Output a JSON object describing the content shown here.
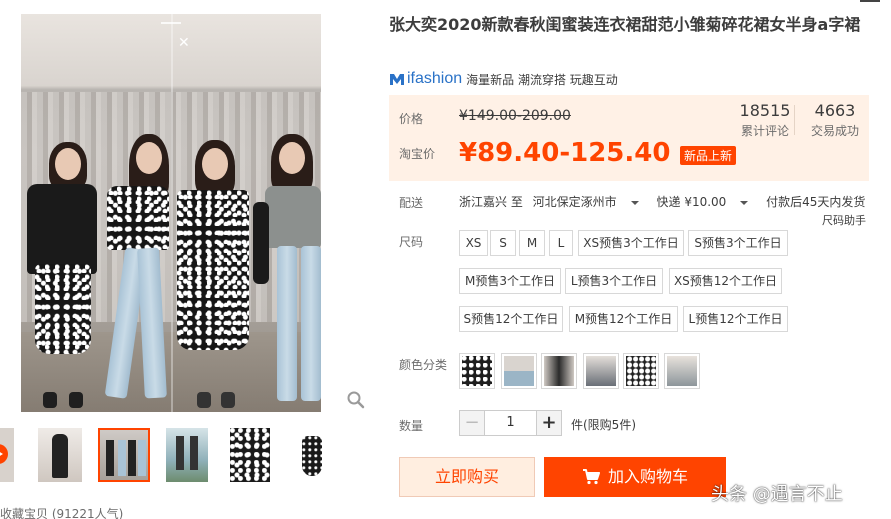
{
  "gallery": {
    "favorite_text": "收藏宝贝 (91221人气)",
    "thumbnail_count": 6
  },
  "product": {
    "title": "张大奕2020新款春秋闺蜜装连衣裙甜范小雏菊碎花裙女半身a字裙"
  },
  "brand": {
    "logo_text": "ifashion",
    "slogan": "海量新品 潮流穿搭 玩趣互动"
  },
  "price": {
    "label": "价格",
    "original": "¥149.00-209.00",
    "sale_label": "淘宝价",
    "sale": "¥89.40-125.40",
    "badge": "新品上新",
    "reviews_count": "18515",
    "reviews_label": "累计评论",
    "sales_count": "4663",
    "sales_label": "交易成功"
  },
  "shipping": {
    "label": "配送",
    "origin": "浙江嘉兴 至",
    "destination": "河北保定涿州市",
    "method": "快递 ¥10.00",
    "promise": "付款后45天内发货"
  },
  "size": {
    "label": "尺码",
    "helper": "尺码助手",
    "options": [
      "XS",
      "S",
      "M",
      "L",
      "XS预售3个工作日",
      "S预售3个工作日",
      "M预售3个工作日",
      "L预售3个工作日",
      "XS预售12个工作日",
      "S预售12个工作日",
      "M预售12个工作日",
      "L预售12个工作日"
    ]
  },
  "color": {
    "label": "颜色分类",
    "swatch_count": 6
  },
  "quantity": {
    "label": "数量",
    "value": "1",
    "minus": "−",
    "plus": "+",
    "note": "件(限购5件)"
  },
  "actions": {
    "buy_now": "立即购买",
    "add_to_cart": "加入购物车"
  },
  "watermark": "头条 @遇言不止",
  "colors": {
    "accent": "#ff4400",
    "price_bg": "#fff1e6",
    "brand_blue": "#2a72c7"
  }
}
